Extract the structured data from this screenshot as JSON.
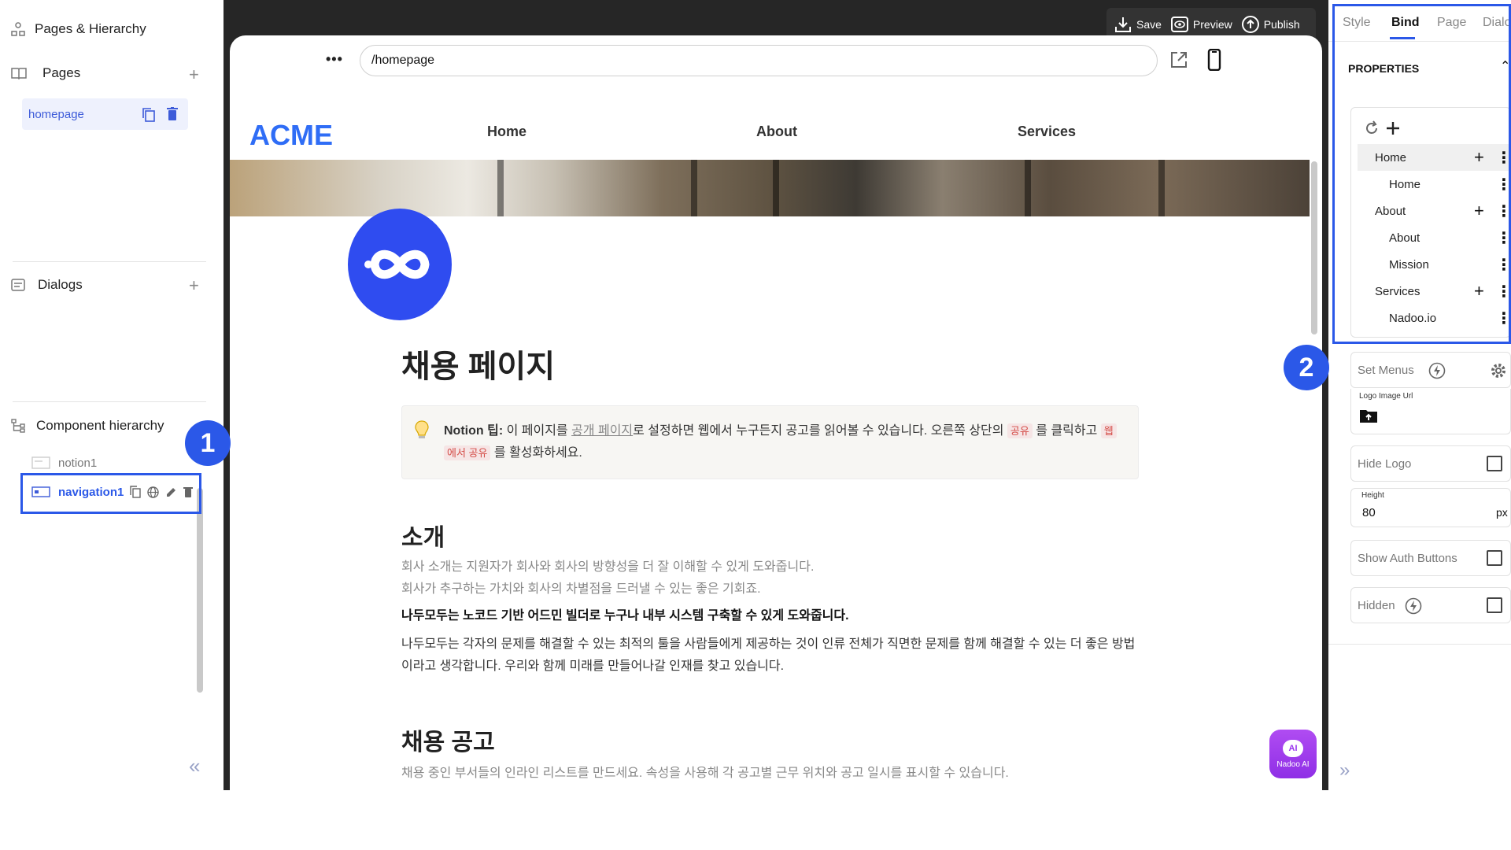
{
  "left_sidebar": {
    "pages_hierarchy_title": "Pages & Hierarchy",
    "pages_label": "Pages",
    "selected_page": "homepage",
    "dialogs_label": "Dialogs",
    "component_hierarchy_label": "Component hierarchy",
    "components": [
      "notion1",
      "navigation1"
    ],
    "collapse_icon": "«"
  },
  "toolbar": {
    "save_label": "Save",
    "preview_label": "Preview",
    "publish_label": "Publish"
  },
  "preview": {
    "url": "/homepage",
    "more_icon": "•••",
    "logo_text": "ACME",
    "nav_items": [
      "Home",
      "About",
      "Services"
    ],
    "page_title": "채용 페이지",
    "callout": {
      "bold": "Notion 팁:",
      "text_1": " 이 페이지를 ",
      "link_1": "공개 페이지",
      "text_2": "로 설정하면 웹에서 누구든지 공고를 읽어볼 수 있습니다. 오른쪽 상단의 ",
      "chip_1": "공유",
      "text_3": " 를 클릭하고 ",
      "chip_2a": "웹",
      "chip_2b": "에서 공유",
      "text_4": " 를 활성화하세요."
    },
    "section_intro": "소개",
    "intro_muted_1": "회사 소개는 지원자가 회사와 회사의 방향성을 더 잘 이해할 수 있게 도와줍니다.",
    "intro_muted_2": "회사가 추구하는 가치와 회사의 차별점을 드러낼 수 있는 좋은 기회죠.",
    "intro_bold": "나두모두는 노코드 기반 어드민 빌더로 누구나 내부 시스템 구축할 수 있게 도와줍니다.",
    "intro_body_1": "나두모두는 각자의 문제를 해결할 수 있는 최적의 툴을 사람들에게 제공하는 것이 인류 전체가 직면한 문제를 함께 해결할 수 있는 더 좋은 방법",
    "intro_body_2": "이라고 생각합니다. 우리와 함께 미래를 만들어나갈 인재를 찾고 있습니다.",
    "section_jobs": "채용 공고",
    "jobs_muted": "채용 중인 부서들의 인라인 리스트를 만드세요. 속성을 사용해 각 공고별 근무 위치와 공고 일시를 표시할 수 있습니다.",
    "ai_button_label": "Nadoo AI",
    "ai_icon_text": "AI"
  },
  "right_panel": {
    "tabs": [
      "Style",
      "Bind",
      "Page",
      "Dialo"
    ],
    "active_tab": "Bind",
    "properties_label": "PROPERTIES",
    "menu_items": [
      {
        "label": "Home",
        "level": 0
      },
      {
        "label": "Home",
        "level": 1
      },
      {
        "label": "About",
        "level": 0
      },
      {
        "label": "About",
        "level": 1
      },
      {
        "label": "Mission",
        "level": 1
      },
      {
        "label": "Services",
        "level": 0
      },
      {
        "label": "Nadoo.io",
        "level": 1
      }
    ],
    "set_menus_label": "Set Menus",
    "logo_image_url_label": "Logo Image Url",
    "hide_logo_label": "Hide Logo",
    "height_label": "Height",
    "height_value": "80",
    "height_unit": "px",
    "show_auth_label": "Show Auth Buttons",
    "hidden_label": "Hidden",
    "expand_icon": "»"
  },
  "annotations": {
    "marker_1": "1",
    "marker_2": "2"
  },
  "colors": {
    "accent": "#2b58e8",
    "logo_blue": "#2f6df6",
    "ai_purple": "#a23cf0"
  }
}
